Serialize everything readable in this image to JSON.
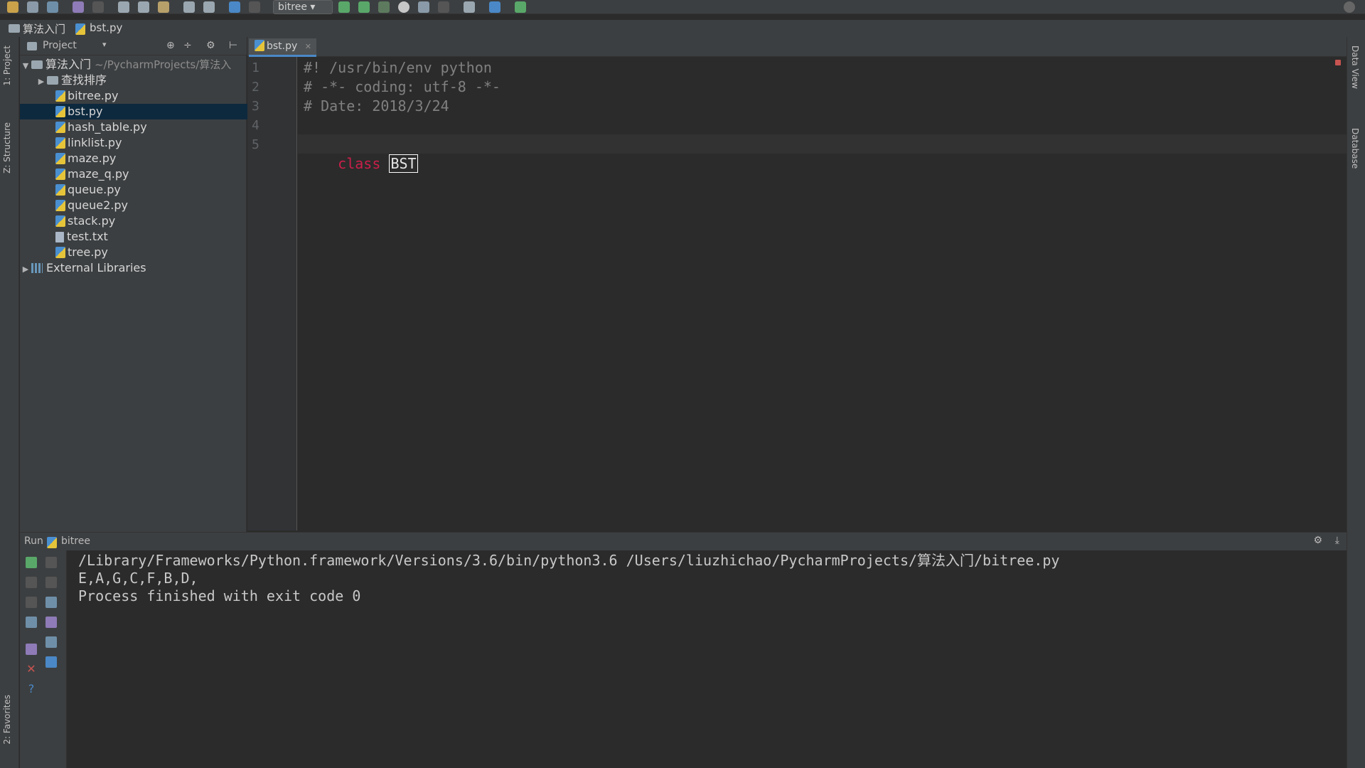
{
  "toolbar": {
    "run_config": "bitree"
  },
  "breadcrumb": {
    "project": "算法入门",
    "file": "bst.py"
  },
  "left_strip": {
    "project_tab": "1: Project",
    "structure_tab": "Z: Structure",
    "favorites_tab": "2: Favorites"
  },
  "project_panel": {
    "title": "Project",
    "root_name": "算法入门",
    "root_path": "~/PycharmProjects/算法入",
    "items": [
      {
        "name": "查找排序",
        "type": "folder"
      },
      {
        "name": "bitree.py",
        "type": "py"
      },
      {
        "name": "bst.py",
        "type": "py",
        "selected": true
      },
      {
        "name": "hash_table.py",
        "type": "py"
      },
      {
        "name": "linklist.py",
        "type": "py"
      },
      {
        "name": "maze.py",
        "type": "py"
      },
      {
        "name": "maze_q.py",
        "type": "py"
      },
      {
        "name": "queue.py",
        "type": "py"
      },
      {
        "name": "queue2.py",
        "type": "py"
      },
      {
        "name": "stack.py",
        "type": "py"
      },
      {
        "name": "test.txt",
        "type": "txt"
      },
      {
        "name": "tree.py",
        "type": "py"
      }
    ],
    "external": "External Libraries"
  },
  "editor": {
    "tab": "bst.py",
    "line_numbers": [
      "1",
      "2",
      "3",
      "4",
      "5"
    ],
    "lines": {
      "l1": "#! /usr/bin/env python",
      "l2": "# -*- coding: utf-8 -*-",
      "l3": "# Date: 2018/3/24",
      "l5_keyword": "class",
      "l5_name": "BST"
    }
  },
  "right_strip": {
    "data_view": "Data View",
    "database": "Database"
  },
  "run": {
    "label": "Run",
    "config": "bitree",
    "output": [
      "/Library/Frameworks/Python.framework/Versions/3.6/bin/python3.6 /Users/liuzhichao/PycharmProjects/算法入门/bitree.py",
      "E,A,G,C,F,B,D,",
      "Process finished with exit code 0"
    ]
  },
  "colors": {
    "accent": "#4a88c7",
    "keyword": "#cc1f4a",
    "run_green": "#59a869",
    "stop_red": "#c75450"
  }
}
